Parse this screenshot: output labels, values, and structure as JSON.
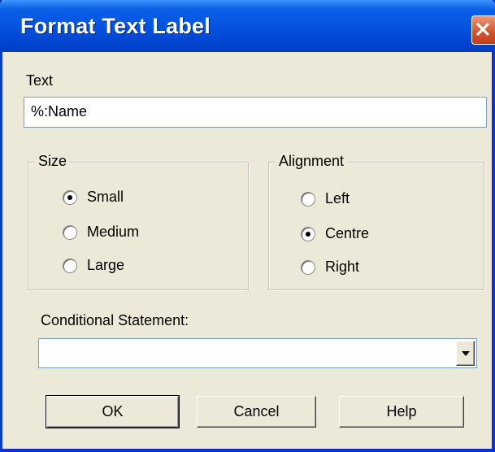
{
  "window": {
    "title": "Format Text Label"
  },
  "text_field": {
    "label": "Text",
    "value": "%:Name"
  },
  "size_group": {
    "title": "Size",
    "options": [
      {
        "label": "Small",
        "selected": true
      },
      {
        "label": "Medium",
        "selected": false
      },
      {
        "label": "Large",
        "selected": false
      }
    ]
  },
  "alignment_group": {
    "title": "Alignment",
    "options": [
      {
        "label": "Left",
        "selected": false
      },
      {
        "label": "Centre",
        "selected": true
      },
      {
        "label": "Right",
        "selected": false
      }
    ]
  },
  "conditional": {
    "label": "Conditional Statement:",
    "value": ""
  },
  "buttons": {
    "ok": "OK",
    "cancel": "Cancel",
    "help": "Help"
  },
  "icons": {
    "close": "close-icon",
    "dropdown": "chevron-down-icon"
  },
  "colors": {
    "titlebar": "#0454e0",
    "close_button": "#d1502c",
    "dialog_bg": "#ece9d8"
  }
}
